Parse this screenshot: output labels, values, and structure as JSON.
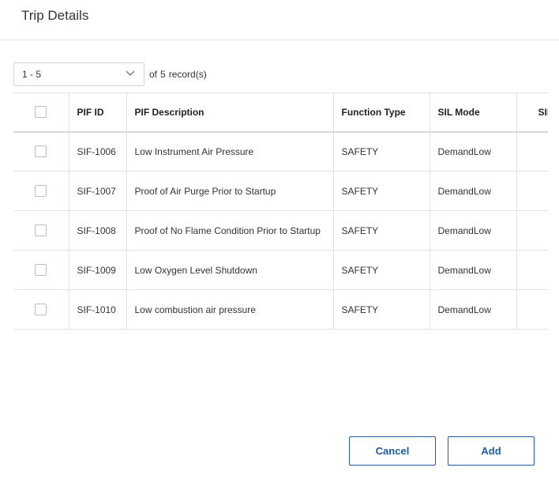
{
  "dialog": {
    "title": "Trip Details"
  },
  "pager": {
    "range": "1 - 5",
    "of_label": "of",
    "total": "5",
    "records_label": "record(s)"
  },
  "table": {
    "columns": [
      "PIF ID",
      "PIF Description",
      "Function Type",
      "SIL Mode",
      "SIL Level"
    ],
    "rows": [
      {
        "pif_id": "SIF-1006",
        "description": "Low Instrument Air Pressure",
        "function_type": "SAFETY",
        "sil_mode": "DemandLow"
      },
      {
        "pif_id": "SIF-1007",
        "description": "Proof of Air Purge Prior to Startup",
        "function_type": "SAFETY",
        "sil_mode": "DemandLow"
      },
      {
        "pif_id": "SIF-1008",
        "description": "Proof of No Flame Condition Prior to Startup",
        "function_type": "SAFETY",
        "sil_mode": "DemandLow"
      },
      {
        "pif_id": "SIF-1009",
        "description": "Low Oxygen Level Shutdown",
        "function_type": "SAFETY",
        "sil_mode": "DemandLow"
      },
      {
        "pif_id": "SIF-1010",
        "description": "Low combustion air pressure",
        "function_type": "SAFETY",
        "sil_mode": "DemandLow"
      }
    ]
  },
  "buttons": {
    "cancel": "Cancel",
    "add": "Add"
  },
  "colors": {
    "accent": "#1f5aa6"
  }
}
